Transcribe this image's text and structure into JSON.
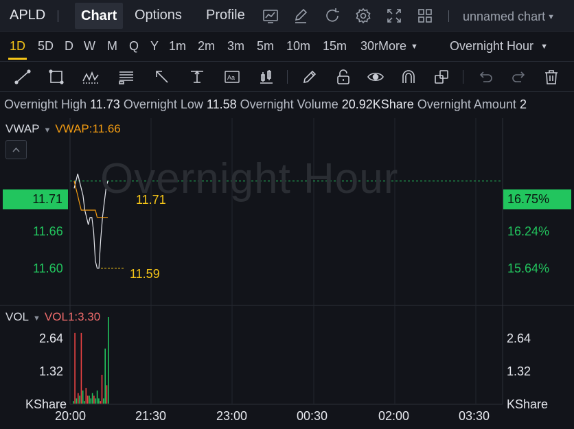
{
  "nav": {
    "ticker": "APLD",
    "tabs": [
      "Chart",
      "Options",
      "Profile"
    ],
    "chart_name": "unnamed chart",
    "icons": [
      "chart-type-icon",
      "edit-icon",
      "refresh-icon",
      "settings-icon",
      "fullscreen-icon",
      "layout-icon"
    ]
  },
  "timeframes": {
    "items": [
      "1D",
      "5D",
      "D",
      "W",
      "M",
      "Q",
      "Y",
      "1m",
      "2m",
      "3m",
      "5m",
      "10m",
      "15m",
      "30r",
      "More"
    ],
    "active": "1D",
    "session": "Overnight Hour"
  },
  "tools": [
    "trendline-icon",
    "rectangle-icon",
    "pattern-icon",
    "fib-icon",
    "arrow-icon",
    "measure-icon",
    "text-icon",
    "indicator-icon",
    "pen-icon",
    "lock-icon",
    "eye-icon",
    "magnet-icon",
    "layers-icon",
    "undo-icon",
    "redo-icon",
    "delete-icon"
  ],
  "info": {
    "high_label": "Overnight High",
    "high": "11.73",
    "low_label": "Overnight Low",
    "low": "11.58",
    "volume_label": "Overnight Volume",
    "volume": "20.92KShare",
    "amount_label": "Overnight Amount",
    "amount": "2"
  },
  "price_panel": {
    "indicator_name": "VWAP",
    "indicator_value": "VWAP:11.66",
    "watermark": "Overnight Hour",
    "current_price": "11.71",
    "current_pct": "16.75%",
    "y_left": [
      "11.66",
      "11.60"
    ],
    "y_right": [
      "16.24%",
      "15.64%"
    ],
    "last_high_label": "11.71",
    "last_low_label": "11.59"
  },
  "volume_panel": {
    "indicator_name": "VOL",
    "indicator_value": "VOL1:3.30",
    "y_labels": [
      "2.64",
      "1.32"
    ],
    "unit": "KShare"
  },
  "x_axis": [
    "20:00",
    "21:30",
    "23:00",
    "00:30",
    "02:00",
    "03:30"
  ],
  "colors": {
    "up": "#22c55e",
    "down": "#ef4444",
    "accent": "#f5c518",
    "vwap": "#f39c12"
  },
  "chart_data": [
    {
      "type": "line",
      "series": [
        {
          "name": "Price",
          "values": [
            11.7,
            11.71,
            11.72,
            11.71,
            11.7,
            11.69,
            11.67,
            11.66,
            11.65,
            11.66,
            11.66,
            11.64,
            11.6,
            11.59,
            11.59,
            11.63,
            11.66,
            11.68,
            11.7,
            11.71
          ]
        },
        {
          "name": "VWAP",
          "values": [
            11.71,
            11.7,
            11.69,
            11.68,
            11.67,
            11.67,
            11.67,
            11.67,
            11.67,
            11.67,
            11.67,
            11.67,
            11.67,
            11.66,
            11.66,
            11.66,
            11.66,
            11.66,
            11.66,
            11.66
          ]
        }
      ],
      "ylim": [
        11.57,
        11.74
      ]
    },
    {
      "type": "bar",
      "series": [
        {
          "name": "VOL",
          "values": [
            0.1,
            2.7,
            0.2,
            0.4,
            0.3,
            2.7,
            0.5,
            0.1,
            0.6,
            0.3,
            0.3,
            0.2,
            0.4,
            0.3,
            0.2,
            0.5,
            0.2,
            0.1,
            1.1,
            0.2,
            2.1,
            0.7,
            3.3
          ]
        }
      ],
      "ylim": [
        0,
        3.3
      ]
    }
  ]
}
